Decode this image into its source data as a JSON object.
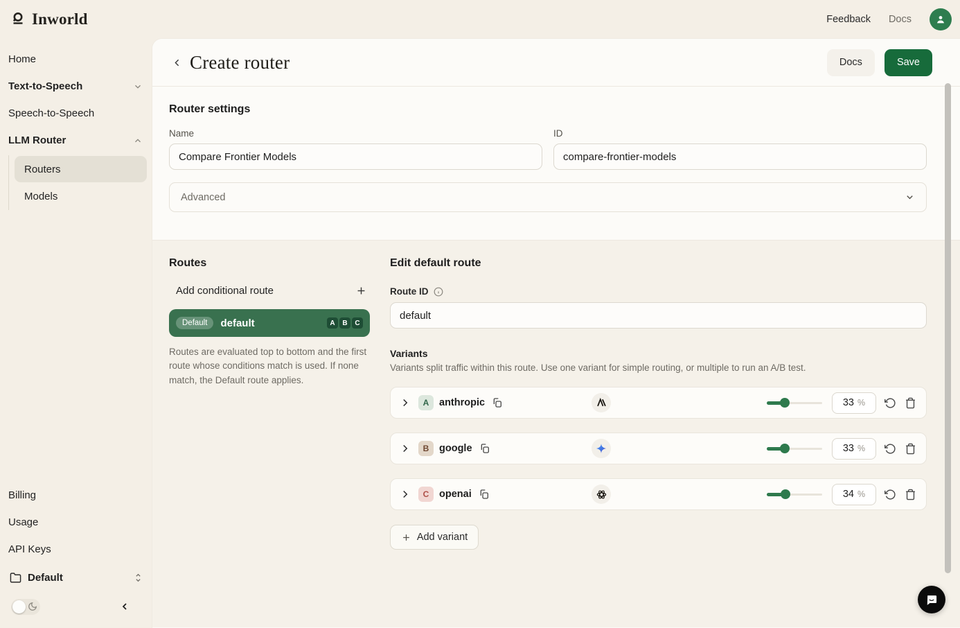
{
  "topbar": {
    "brand": "Inworld",
    "feedback_label": "Feedback",
    "docs_label": "Docs"
  },
  "sidebar": {
    "items": [
      {
        "label": "Home"
      },
      {
        "label": "Text-to-Speech"
      },
      {
        "label": "Speech-to-Speech"
      },
      {
        "label": "LLM Router"
      }
    ],
    "llm_router_children": [
      {
        "label": "Routers",
        "selected": true
      },
      {
        "label": "Models",
        "selected": false
      }
    ],
    "footer_items": [
      {
        "label": "Billing"
      },
      {
        "label": "Usage"
      },
      {
        "label": "API Keys"
      }
    ],
    "workspace_label": "Default"
  },
  "header": {
    "title": "Create router",
    "docs_button": "Docs",
    "save_button": "Save"
  },
  "router_settings": {
    "heading": "Router settings",
    "name_label": "Name",
    "name_value": "Compare Frontier Models",
    "id_label": "ID",
    "id_value": "compare-frontier-models",
    "advanced_label": "Advanced"
  },
  "routes": {
    "heading": "Routes",
    "add_conditional_route": "Add conditional route",
    "default_route": {
      "badge": "Default",
      "name": "default",
      "letters": [
        "A",
        "B",
        "C"
      ]
    },
    "description": "Routes are evaluated top to bottom and the first route whose conditions match is used. If none match, the Default route applies."
  },
  "edit_route": {
    "heading": "Edit default route",
    "route_id_label": "Route ID",
    "route_id_value": "default",
    "variants_heading": "Variants",
    "variants_description": "Variants split traffic within this route. Use one variant for simple routing, or multiple to run an A/B test.",
    "variants": [
      {
        "letter": "A",
        "name": "anthropic",
        "provider_icon": "anthropic-logo",
        "percent": "33",
        "unit": "%",
        "slider_percent": 33
      },
      {
        "letter": "B",
        "name": "google",
        "provider_icon": "gemini-logo",
        "percent": "33",
        "unit": "%",
        "slider_percent": 33
      },
      {
        "letter": "C",
        "name": "openai",
        "provider_icon": "openai-logo",
        "percent": "34",
        "unit": "%",
        "slider_percent": 34
      }
    ],
    "add_variant_label": "Add variant"
  },
  "colors": {
    "accent_green": "#176B3B",
    "route_card_green": "#39714F",
    "background_cream": "#F4EFE6",
    "panel_white": "#FBFAF6"
  }
}
